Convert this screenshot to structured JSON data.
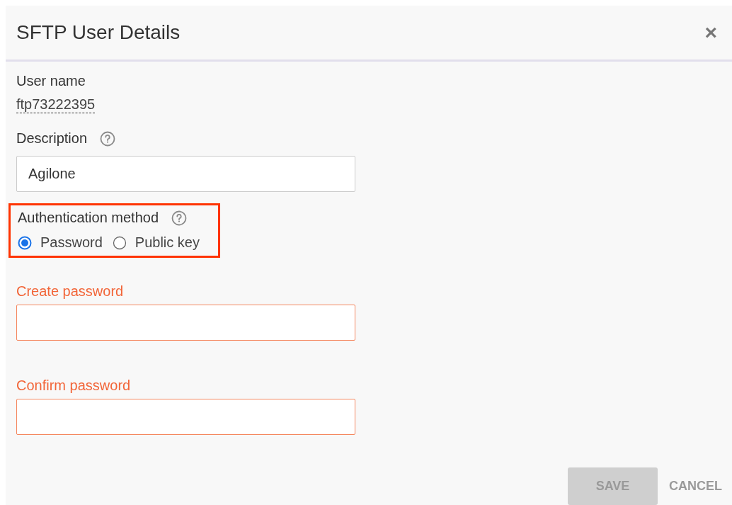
{
  "dialog": {
    "title": "SFTP User Details",
    "close": "×"
  },
  "user_name": {
    "label": "User name",
    "value": "ftp73222395"
  },
  "description": {
    "label": "Description",
    "value": "Agilone"
  },
  "auth": {
    "label": "Authentication method",
    "highlighted": true,
    "options": [
      {
        "label": "Password",
        "selected": true
      },
      {
        "label": "Public key",
        "selected": false
      }
    ]
  },
  "password_fields": [
    {
      "label": "Create password",
      "invalid": true
    },
    {
      "label": "Confirm password",
      "invalid": true
    }
  ],
  "buttons": [
    {
      "label": "SAVE",
      "kind": "primary",
      "disabled": true
    },
    {
      "label": "CANCEL",
      "kind": "text",
      "disabled": false
    }
  ]
}
